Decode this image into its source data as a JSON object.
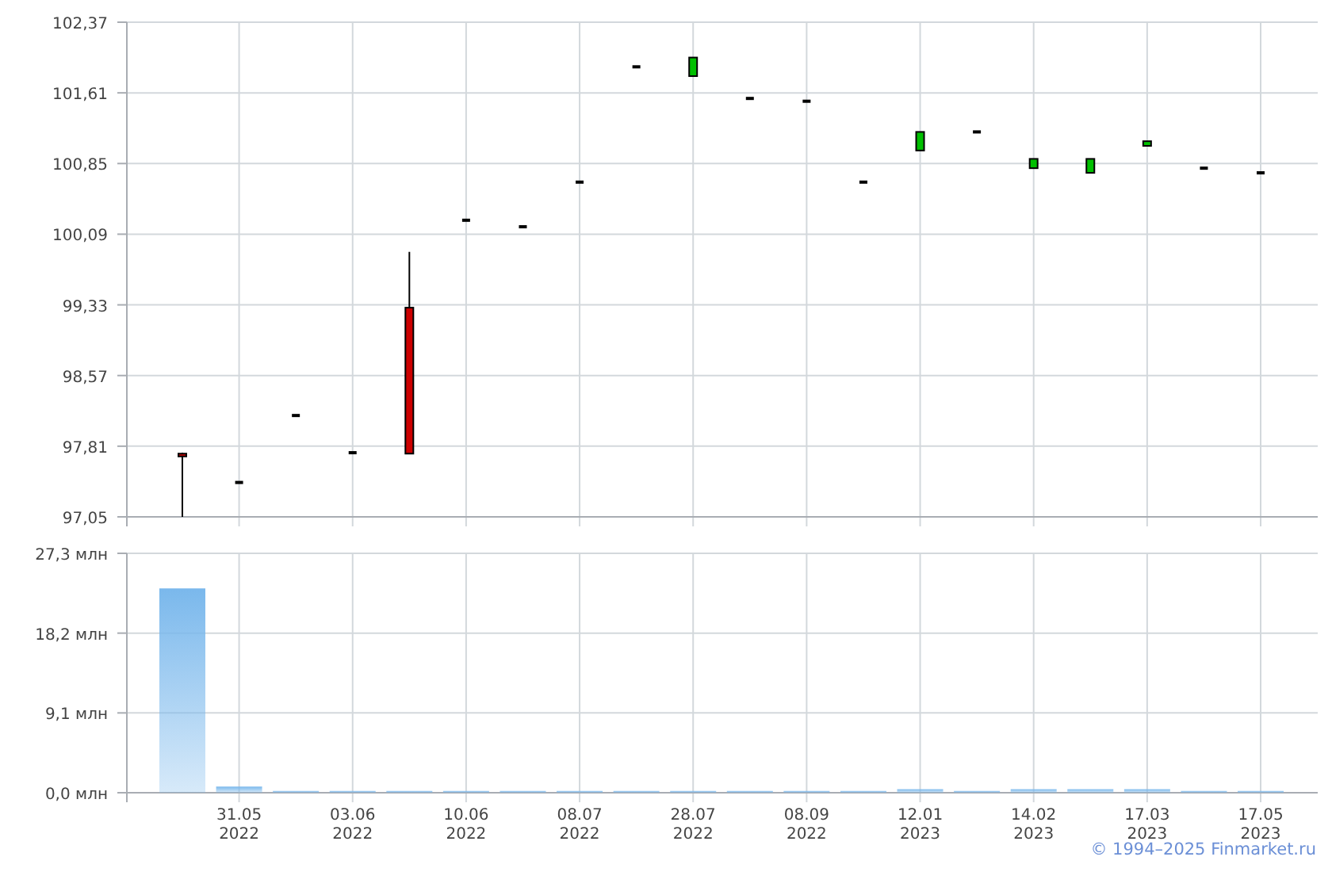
{
  "price_chart": {
    "chart_data": {
      "type": "candlestick",
      "grid": true,
      "categories": [
        null,
        null,
        null,
        null,
        null,
        null,
        null,
        null,
        null,
        null,
        null,
        null,
        null,
        null,
        null,
        null,
        null,
        null,
        null,
        null
      ],
      "ohlc": [
        [
          97.73,
          97.74,
          97.05,
          97.7
        ],
        [
          97.42,
          97.42,
          97.42,
          97.42
        ],
        [
          98.14,
          98.14,
          98.14,
          98.14
        ],
        [
          97.74,
          97.74,
          97.74,
          97.74
        ],
        [
          99.3,
          99.9,
          97.73,
          97.73
        ],
        [
          100.24,
          100.24,
          100.24,
          100.24
        ],
        [
          100.17,
          100.17,
          100.17,
          100.17
        ],
        [
          100.65,
          100.65,
          100.65,
          100.65
        ],
        [
          101.89,
          101.89,
          101.89,
          101.89
        ],
        [
          101.79,
          101.99,
          101.79,
          101.99
        ],
        [
          101.55,
          101.55,
          101.55,
          101.55
        ],
        [
          101.52,
          101.52,
          101.52,
          101.52
        ],
        [
          100.65,
          100.65,
          100.65,
          100.65
        ],
        [
          100.99,
          101.19,
          100.99,
          101.19
        ],
        [
          101.19,
          101.19,
          101.19,
          101.19
        ],
        [
          100.8,
          100.9,
          100.8,
          100.9
        ],
        [
          100.75,
          100.9,
          100.75,
          100.9
        ],
        [
          101.04,
          101.09,
          101.04,
          101.09
        ],
        [
          100.8,
          100.8,
          100.8,
          100.8
        ],
        [
          100.75,
          100.75,
          100.75,
          100.75
        ]
      ],
      "ylim": [
        97.05,
        102.37
      ],
      "yticks": [
        {
          "value": 97.05,
          "label": "97,05"
        },
        {
          "value": 97.81,
          "label": "97,81"
        },
        {
          "value": 98.57,
          "label": "98,57"
        },
        {
          "value": 99.33,
          "label": "99,33"
        },
        {
          "value": 100.09,
          "label": "100,09"
        },
        {
          "value": 100.85,
          "label": "100,85"
        },
        {
          "value": 101.61,
          "label": "101,61"
        },
        {
          "value": 102.37,
          "label": "102,37"
        }
      ]
    }
  },
  "volume_chart": {
    "chart_data": {
      "type": "bar",
      "grid": true,
      "categories": [
        null,
        "31.05 2022",
        null,
        "03.06 2022",
        null,
        "10.06 2022",
        null,
        "08.07 2022",
        null,
        "28.07 2022",
        null,
        "08.09 2022",
        null,
        "12.01 2023",
        null,
        "14.02 2023",
        null,
        "17.03 2023",
        null,
        "17.05 2023"
      ],
      "values": [
        23.3,
        0.7,
        0.2,
        0.2,
        0.2,
        0.2,
        0.2,
        0.2,
        0.2,
        0.2,
        0.2,
        0.2,
        0.2,
        0.4,
        0.2,
        0.4,
        0.4,
        0.4,
        0.2,
        0.2
      ],
      "ylim": [
        0,
        27.3
      ],
      "yticks": [
        {
          "value": 0,
          "label": "0,0 млн"
        },
        {
          "value": 9.1,
          "label": "9,1 млн"
        },
        {
          "value": 18.2,
          "label": "18,2 млн"
        },
        {
          "value": 27.3,
          "label": "27,3 млн"
        }
      ]
    }
  },
  "credit": "© 1994–2025 Finmarket.ru"
}
